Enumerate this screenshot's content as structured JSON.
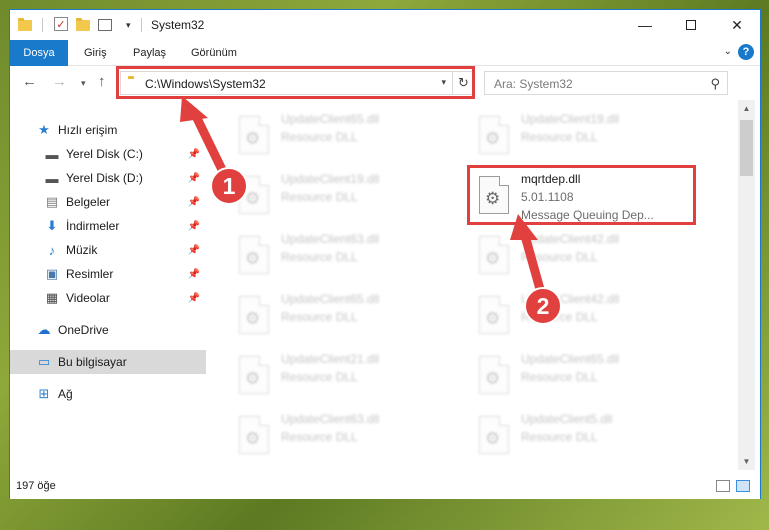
{
  "window": {
    "title": "System32"
  },
  "ribbon": {
    "tabs": [
      "Dosya",
      "Giriş",
      "Paylaş",
      "Görünüm"
    ]
  },
  "address": {
    "path": "C:\\Windows\\System32"
  },
  "search": {
    "placeholder": "Ara: System32"
  },
  "sidebar": {
    "items": [
      {
        "label": "Hızlı erişim",
        "icon": "star-icon"
      },
      {
        "label": "Yerel Disk (C:)",
        "icon": "drive-icon",
        "pinned": true
      },
      {
        "label": "Yerel Disk (D:)",
        "icon": "drive-icon",
        "pinned": true
      },
      {
        "label": "Belgeler",
        "icon": "document-icon",
        "pinned": true
      },
      {
        "label": "İndirmeler",
        "icon": "download-icon",
        "pinned": true
      },
      {
        "label": "Müzik",
        "icon": "music-icon",
        "pinned": true
      },
      {
        "label": "Resimler",
        "icon": "picture-icon",
        "pinned": true
      },
      {
        "label": "Videolar",
        "icon": "video-icon",
        "pinned": true
      },
      {
        "label": "OneDrive",
        "icon": "cloud-icon"
      },
      {
        "label": "Bu bilgisayar",
        "icon": "computer-icon",
        "selected": true
      },
      {
        "label": "Ağ",
        "icon": "network-icon"
      }
    ]
  },
  "files": {
    "left": [
      {
        "name": "UpdateClient65.dll",
        "type": "Resource DLL"
      },
      {
        "name": "UpdateClient19.dll",
        "type": "Resource DLL"
      },
      {
        "name": "UpdateClient63.dll",
        "type": "Resource DLL"
      },
      {
        "name": "UpdateClient65.dll",
        "type": "Resource DLL"
      },
      {
        "name": "UpdateClient21.dll",
        "type": "Resource DLL"
      },
      {
        "name": "UpdateClient63.dll",
        "type": "Resource DLL"
      }
    ],
    "right": [
      {
        "name": "UpdateClient19.dll",
        "type": "Resource DLL"
      },
      {
        "name": "UpdateClient42.dll",
        "type": "Resource DLL"
      },
      {
        "name": "UpdateClient42.dll",
        "type": "Resource DLL"
      },
      {
        "name": "UpdateClient65.dll",
        "type": "Resource DLL"
      },
      {
        "name": "UpdateClient5.dll",
        "type": "Resource DLL"
      }
    ],
    "highlighted": {
      "name": "mqrtdep.dll",
      "version": "5.01.1108",
      "description": "Message Queuing Dep..."
    }
  },
  "status": {
    "count": "197 öğe"
  },
  "annotations": {
    "step1": "1",
    "step2": "2",
    "color": "#e0403e"
  }
}
